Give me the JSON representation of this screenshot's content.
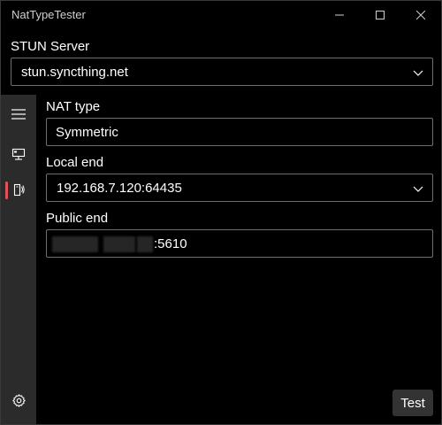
{
  "window": {
    "title": "NatTypeTester"
  },
  "stun": {
    "label": "STUN Server",
    "value": "stun.syncthing.net"
  },
  "nav": {
    "icons": [
      "hamburger-menu-icon",
      "server-icon",
      "port-mapping-icon",
      "gear-icon"
    ],
    "selected": "port-mapping",
    "accent_color": "#e2525a"
  },
  "content": {
    "nat_type": {
      "label": "NAT type",
      "value": "Symmetric"
    },
    "local_end": {
      "label": "Local end",
      "value": "192.168.7.120:64435"
    },
    "public_end": {
      "label": "Public end",
      "value_visible": ":5610"
    }
  },
  "actions": {
    "test_label": "Test"
  }
}
